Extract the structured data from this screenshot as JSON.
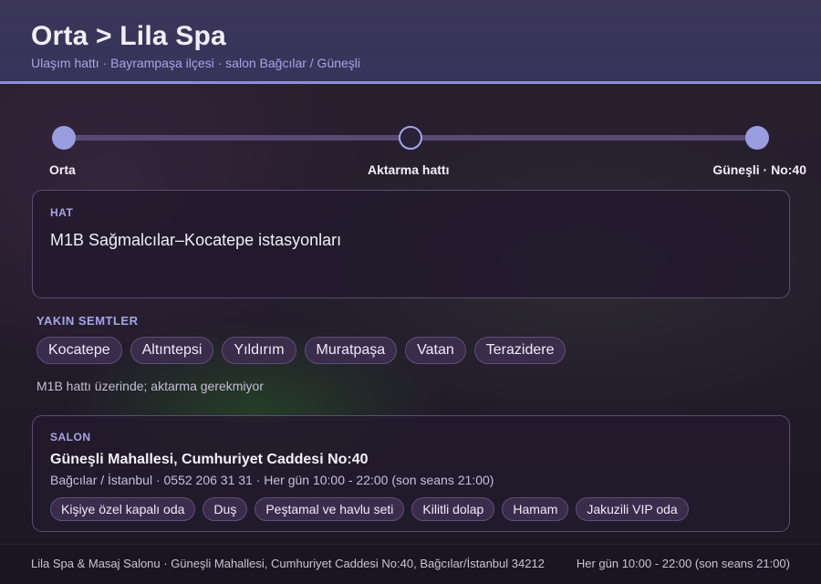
{
  "header": {
    "title": "Orta > Lila Spa",
    "subtitle": "Ulaşım hattı · Bayrampaşa ilçesi · salon Bağcılar / Güneşli"
  },
  "route": {
    "start_label": "Orta",
    "mid_label": "Aktarma hattı",
    "end_label": "Güneşli · No:40"
  },
  "line": {
    "label": "HAT",
    "value": "M1B Sağmalcılar–Kocatepe istasyonları"
  },
  "nearby": {
    "title": "YAKIN SEMTLER",
    "items": [
      "Kocatepe",
      "Altıntepsi",
      "Yıldırım",
      "Muratpaşa",
      "Vatan",
      "Terazidere"
    ],
    "note": "M1B hattı üzerinde; aktarma gerekmiyor"
  },
  "salon": {
    "label": "SALON",
    "address": "Güneşli Mahallesi, Cumhuriyet Caddesi No:40",
    "meta": "Bağcılar / İstanbul · 0552 206 31 31 · Her gün 10:00 - 22:00 (son seans 21:00)",
    "amenities": [
      "Kişiye özel kapalı oda",
      "Duş",
      "Peştamal ve havlu seti",
      "Kilitli dolap",
      "Hamam",
      "Jakuzili VIP oda"
    ]
  },
  "footer": {
    "left": "Lila Spa & Masaj Salonu · Güneşli Mahallesi, Cumhuriyet Caddesi No:40, Bağcılar/İstanbul 34212",
    "right": "Her gün 10:00 - 22:00 (son seans 21:00)"
  },
  "colors": {
    "accent": "#8d8fd6",
    "header_bg": "#3b3658",
    "chip_bg": "#3a2d4c"
  }
}
